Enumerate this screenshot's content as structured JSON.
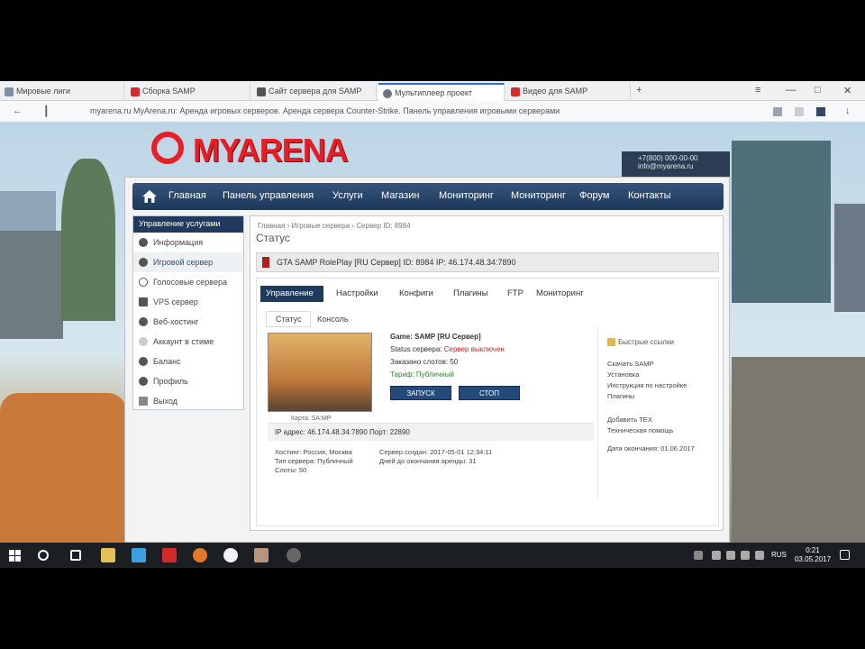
{
  "browser": {
    "tabs": [
      {
        "label": "Мировые лиги",
        "color": "#7d8fa6"
      },
      {
        "label": "Сборка SAMP",
        "color": "#d92b2b"
      },
      {
        "label": "Сайт сервера для SAMP",
        "color": "#555555"
      },
      {
        "label": "Мультиплеер проект",
        "color": "#6b7380",
        "active": true
      },
      {
        "label": "Видео для SAMP",
        "color": "#d92b2b"
      }
    ],
    "url": "myarena.ru  MyArena.ru: Аренда игровых серверов. Аренда сервера Counter-Strike. Панель управления игровыми серверами"
  },
  "site": {
    "logo_text": "MYARENA",
    "contact_phone": "+7(800) 000-00-00",
    "contact_email": "info@myarena.ru",
    "nav": [
      "Главная",
      "Панель управления",
      "Услуги",
      "Магазин",
      "Мониторинг",
      "Мониторинг",
      "Форум",
      "Контакты"
    ],
    "sidebar": {
      "title": "Управление услугами",
      "items": [
        {
          "label": "Информация",
          "icon": "info-icon"
        },
        {
          "label": "Игровой сервер",
          "icon": "gamepad-icon",
          "selected": true
        },
        {
          "label": "Голосовые сервера",
          "icon": "mic-icon"
        },
        {
          "label": "VPS сервер",
          "icon": "server-icon"
        },
        {
          "label": "Веб-хостинг",
          "icon": "globe-icon"
        },
        {
          "label": "Аккаунт в стиме",
          "icon": "steam-icon"
        },
        {
          "label": "Баланс",
          "icon": "wallet-icon"
        },
        {
          "label": "Профиль",
          "icon": "user-icon"
        },
        {
          "label": "Выход",
          "icon": "logout-icon"
        }
      ]
    },
    "breadcrumbs": "Главная › Игровые сервера › Сервер ID: 8984",
    "page_title": "Статус",
    "server_line": "GTA SAMP RolePlay [RU Сервер] ID: 8984  IP: 46.174.48.34:7890",
    "main_tabs": [
      "Управление",
      "Настройки",
      "Конфиги",
      "Плагины",
      "FTP",
      "Мониторинг"
    ],
    "sub_tabs": [
      "Статус",
      "Консоль"
    ],
    "server_info": {
      "name": "Game: SAMP [RU Сервер]",
      "status_label": "Status сервера:",
      "status_value": "Сервер выключен",
      "slots": "Заказано слотов: 50",
      "tariff": "Тариф: Публичный",
      "start_label": "ЗАПУСК",
      "stop_label": "СТОП",
      "image_caption": "Карта: SA:MP"
    },
    "ip_line": "IP адрес: 46.174.48.34:7890  Порт: 22890",
    "stats": {
      "left": [
        "Хостинг: Россия, Москва",
        "Тип сервера: Публичный",
        "Слоты: 50"
      ],
      "right": [
        "Сервер создан: 2017-05-01 12:34:11",
        "Дней до окончания аренды: 31"
      ]
    },
    "right_panel": {
      "title": "Быстрые ссылки",
      "items": [
        "Скачать SAMP",
        "Установка",
        "Инструкция по настройке",
        "Плагины",
        "Добавить ТЕХ",
        "Техническая помощь",
        "Дата окончания: 01.06.2017"
      ]
    }
  },
  "taskbar": {
    "time": "0:21",
    "date": "03.05.2017",
    "lang": "RUS"
  }
}
